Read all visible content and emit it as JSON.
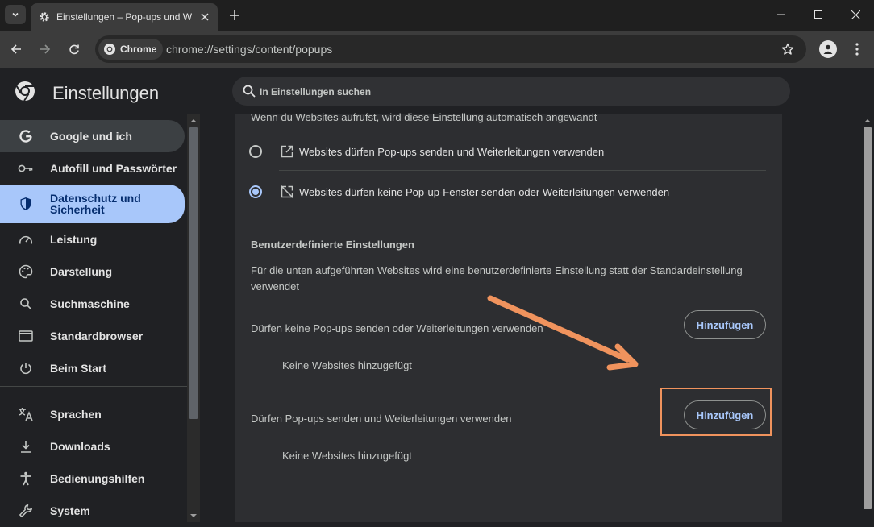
{
  "browser": {
    "tab_title": "Einstellungen – Pop-ups und Weiterleitungen",
    "chip_label": "Chrome",
    "url": "chrome://settings/content/popups"
  },
  "header": {
    "title": "Einstellungen",
    "search_placeholder": "In Einstellungen suchen"
  },
  "sidebar": {
    "items": [
      {
        "label": "Google und ich",
        "icon": "google-icon"
      },
      {
        "label": "Autofill und Passwörter",
        "icon": "key-icon"
      },
      {
        "label": "Datenschutz und Sicherheit",
        "icon": "shield-icon"
      },
      {
        "label": "Leistung",
        "icon": "speedometer-icon"
      },
      {
        "label": "Darstellung",
        "icon": "palette-icon"
      },
      {
        "label": "Suchmaschine",
        "icon": "search-icon"
      },
      {
        "label": "Standardbrowser",
        "icon": "browser-window-icon"
      },
      {
        "label": "Beim Start",
        "icon": "power-icon"
      },
      {
        "label": "Sprachen",
        "icon": "translate-icon"
      },
      {
        "label": "Downloads",
        "icon": "download-icon"
      },
      {
        "label": "Bedienungshilfen",
        "icon": "accessibility-icon"
      },
      {
        "label": "System",
        "icon": "wrench-icon"
      }
    ]
  },
  "content": {
    "default_desc": "Wenn du Websites aufrufst, wird diese Einstellung automatisch angewandt",
    "options": [
      {
        "label": "Websites dürfen Pop-ups senden und Weiterleitungen verwenden",
        "checked": false,
        "icon": "open-in-new-icon"
      },
      {
        "label": "Websites dürfen keine Pop-up-Fenster senden oder Weiterleitungen verwenden",
        "checked": true,
        "icon": "popup-blocked-icon"
      }
    ],
    "custom_title": "Benutzerdefinierte Einstellungen",
    "custom_desc": "Für die unten aufgeführten Websites wird eine benutzerdefinierte Einstellung statt der Standardeinstellung verwendet",
    "block_list": {
      "label": "Dürfen keine Pop-ups senden oder Weiterleitungen verwenden",
      "button": "Hinzufügen",
      "empty": "Keine Websites hinzugefügt"
    },
    "allow_list": {
      "label": "Dürfen Pop-ups senden und Weiterleitungen verwenden",
      "button": "Hinzufügen",
      "empty": "Keine Websites hinzugefügt"
    }
  },
  "colors": {
    "accent": "#a8c7fa",
    "annotation": "#f0935d"
  }
}
